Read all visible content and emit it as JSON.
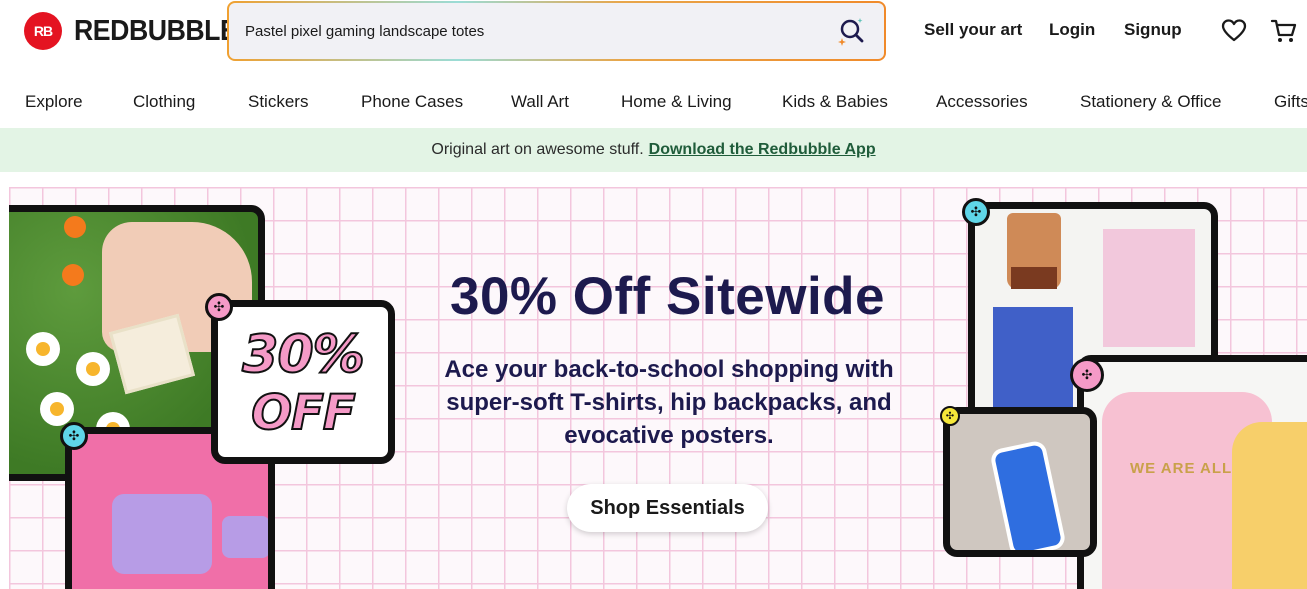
{
  "header": {
    "logo_badge": "RB",
    "logo_text": "REDBUBBLE",
    "search": {
      "value": "Pastel pixel gaming landscape totes",
      "icon": "search-sparkle-icon"
    },
    "links": {
      "sell": "Sell your art",
      "login": "Login",
      "signup": "Signup"
    },
    "icons": [
      "heart-icon",
      "cart-icon"
    ]
  },
  "categories": [
    "Explore",
    "Clothing",
    "Stickers",
    "Phone Cases",
    "Wall Art",
    "Home & Living",
    "Kids & Babies",
    "Accessories",
    "Stationery & Office",
    "Gifts"
  ],
  "promo_strip": {
    "text": "Original art on awesome stuff.",
    "link": "Download the Redbubble App",
    "background": "#e3f4e5"
  },
  "hero": {
    "title": "30% Off Sitewide",
    "subtitle": "Ace your back-to-school shopping with super-soft T-shirts, hip backpacks, and evocative posters.",
    "cta": "Shop Essentials",
    "badge_line1": "30%",
    "badge_line2": "OFF",
    "shirt_text": "WE ARE ALL WEIRD",
    "colors": {
      "title": "#1d1a4e",
      "grid": "#f3c6dd",
      "badge_pink": "#f59ac7",
      "brand_red": "#e41321"
    }
  }
}
